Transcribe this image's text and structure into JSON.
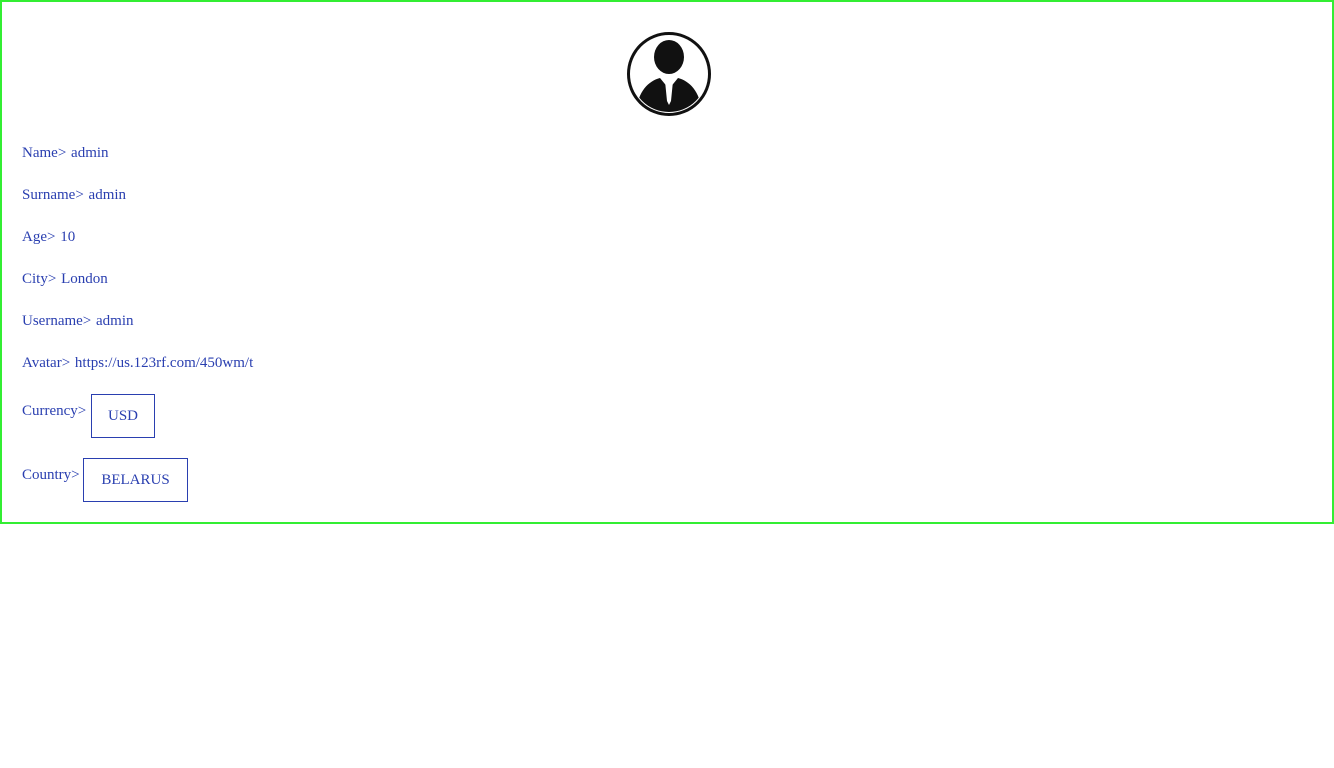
{
  "avatar": {
    "icon": "user-silhouette-icon"
  },
  "fields": {
    "name": {
      "label": "Name>",
      "value": "admin"
    },
    "surname": {
      "label": "Surname>",
      "value": "admin"
    },
    "age": {
      "label": "Age>",
      "value": "10"
    },
    "city": {
      "label": "City>",
      "value": "London"
    },
    "username": {
      "label": "Username>",
      "value": "admin"
    },
    "avatar_url": {
      "label": "Avatar>",
      "value": "https://us.123rf.com/450wm/t"
    }
  },
  "selects": {
    "currency": {
      "label": "Currency>",
      "value": "USD"
    },
    "country": {
      "label": "Country>",
      "value": "BELARUS"
    }
  },
  "colors": {
    "border": "#33ee33",
    "text": "#2a3fb0",
    "icon": "#111111"
  }
}
